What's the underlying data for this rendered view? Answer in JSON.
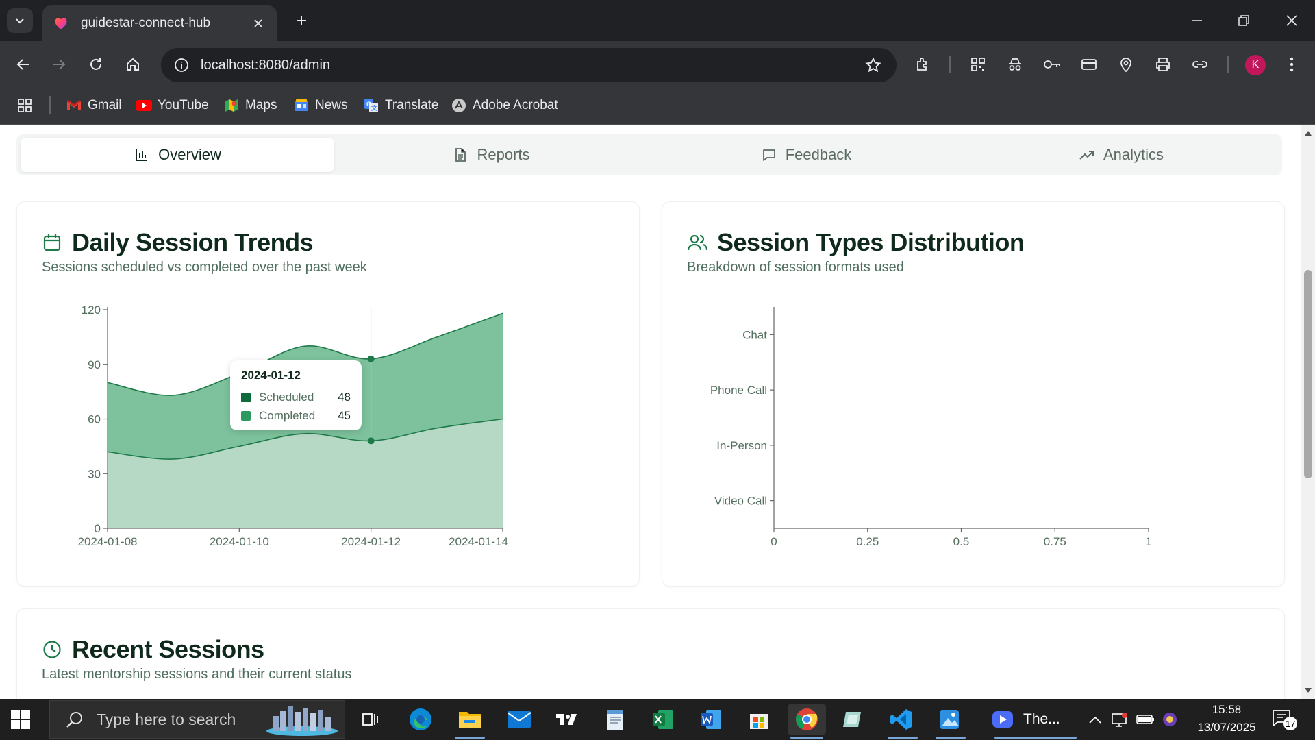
{
  "browser": {
    "tab_title": "guidestar-connect-hub",
    "url": "localhost:8080/admin",
    "profile_initial": "K",
    "bookmarks": [
      {
        "label": "Gmail",
        "icon": "gmail-icon"
      },
      {
        "label": "YouTube",
        "icon": "youtube-icon"
      },
      {
        "label": "Maps",
        "icon": "maps-icon"
      },
      {
        "label": "News",
        "icon": "news-icon"
      },
      {
        "label": "Translate",
        "icon": "translate-icon"
      },
      {
        "label": "Adobe Acrobat",
        "icon": "acrobat-icon"
      }
    ]
  },
  "tabs": [
    {
      "label": "Overview",
      "icon": "bar-chart-icon",
      "active": true
    },
    {
      "label": "Reports",
      "icon": "file-text-icon",
      "active": false
    },
    {
      "label": "Feedback",
      "icon": "message-square-icon",
      "active": false
    },
    {
      "label": "Analytics",
      "icon": "trending-up-icon",
      "active": false
    }
  ],
  "trends_card": {
    "title": "Daily Session Trends",
    "subtitle": "Sessions scheduled vs completed over the past week",
    "icon": "calendar-icon"
  },
  "types_card": {
    "title": "Session Types Distribution",
    "subtitle": "Breakdown of session formats used",
    "icon": "users-icon"
  },
  "recent_card": {
    "title": "Recent Sessions",
    "subtitle": "Latest mentorship sessions and their current status",
    "icon": "clock-icon"
  },
  "tooltip": {
    "date": "2024-01-12",
    "rows": [
      {
        "name": "Scheduled",
        "value": "48",
        "color": "#0f6b3c"
      },
      {
        "name": "Completed",
        "value": "45",
        "color": "#2e9a5f"
      }
    ]
  },
  "chart_data": [
    {
      "type": "area",
      "stacked": true,
      "x": [
        "2024-01-08",
        "2024-01-09",
        "2024-01-10",
        "2024-01-11",
        "2024-01-12",
        "2024-01-13",
        "2024-01-14"
      ],
      "x_tick_labels": [
        "2024-01-08",
        "2024-01-10",
        "2024-01-12",
        "2024-01-14"
      ],
      "series": [
        {
          "name": "Completed",
          "values": [
            42,
            38,
            45,
            52,
            48,
            55,
            60
          ],
          "color": "#b6d9c5",
          "stroke": "#1f7a4a"
        },
        {
          "name": "Scheduled",
          "values": [
            38,
            35,
            40,
            48,
            45,
            50,
            58
          ],
          "color": "#7dc29c",
          "stroke": "#1f7a4a"
        }
      ],
      "ylim": [
        0,
        120
      ],
      "y_ticks": [
        0,
        30,
        60,
        90,
        120
      ],
      "highlight_x": "2024-01-12",
      "grid": false
    },
    {
      "type": "bar",
      "orientation": "horizontal",
      "categories": [
        "Chat",
        "Phone Call",
        "In-Person",
        "Video Call"
      ],
      "values": [
        0,
        0,
        0,
        0
      ],
      "xlim": [
        0,
        1
      ],
      "x_ticks": [
        "0",
        "0.25",
        "0.5",
        "0.75",
        "1"
      ],
      "grid": false
    }
  ],
  "taskbar": {
    "search_placeholder": "Type here to search",
    "zoom_label": "The...",
    "time": "15:58",
    "date": "13/07/2025",
    "notification_count": "17"
  }
}
